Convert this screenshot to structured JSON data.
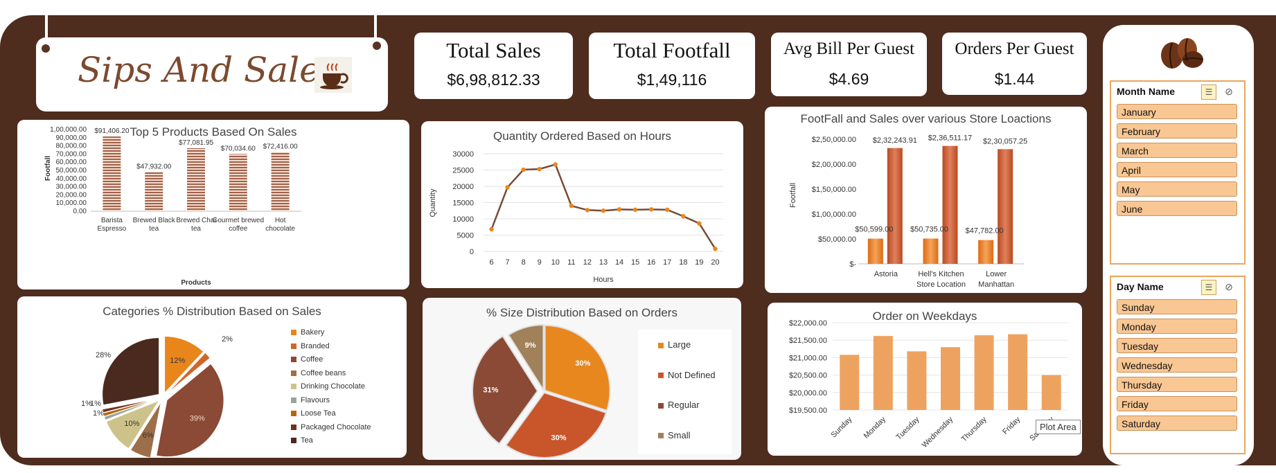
{
  "title": "Sips And Sales",
  "kpis": {
    "total_sales": {
      "label": "Total Sales",
      "value": "$6,98,812.33"
    },
    "total_footfall": {
      "label": "Total Footfall",
      "value": "$1,49,116"
    },
    "avg_bill": {
      "label": "Avg Bill Per Guest",
      "value": "$4.69"
    },
    "orders_per_guest": {
      "label": "Orders Per Guest",
      "value": "$1.44"
    }
  },
  "colors": {
    "background": "#4e2c1e",
    "orange": "#e8871e",
    "rust": "#c8562a",
    "brown": "#8a4a36",
    "tan": "#a0815a",
    "weekday_bar": "#eda35f"
  },
  "chart_data": [
    {
      "id": "top5",
      "type": "bar",
      "title": "Top 5 Products Based On Sales",
      "xlabel": "Products",
      "ylabel": "Footfall",
      "categories": [
        "Barista Espresso",
        "Brewed Black tea",
        "Brewed Chai tea",
        "Gourmet brewed coffee",
        "Hot chocolate"
      ],
      "values": [
        91406.2,
        47932.0,
        77081.95,
        70034.6,
        72416.0
      ],
      "data_labels": [
        "$91,406.20",
        "$47,932.00",
        "$77,081.95",
        "$70,034.60",
        "$72,416.00"
      ],
      "yticks": [
        "0.00",
        "10,000.00",
        "20,000.00",
        "30,000.00",
        "40,000.00",
        "50,000.00",
        "60,000.00",
        "70,000.00",
        "80,000.00",
        "90,000.00",
        "1,00,000.00"
      ],
      "ylim": [
        0,
        100000
      ]
    },
    {
      "id": "hours",
      "type": "line",
      "title": "Quantity Ordered Based on Hours",
      "xlabel": "Hours",
      "ylabel": "Quantity",
      "x": [
        6,
        7,
        8,
        9,
        10,
        11,
        12,
        13,
        14,
        15,
        16,
        17,
        18,
        19,
        20
      ],
      "values": [
        6800,
        19700,
        25100,
        25300,
        26700,
        14000,
        12700,
        12500,
        12900,
        12800,
        12900,
        12800,
        10800,
        8600,
        800
      ],
      "yticks": [
        "0",
        "5000",
        "10000",
        "15000",
        "20000",
        "25000",
        "30000"
      ],
      "ylim": [
        0,
        30000
      ]
    },
    {
      "id": "stores",
      "type": "bar",
      "title": "FootFall and Sales over various Store Loactions",
      "ylabel": "Footfall",
      "categories": [
        "Astoria",
        "Hell's Kitchen Store Location",
        "Lower Manhattan"
      ],
      "series": [
        {
          "values": [
            50599.0,
            50735.0,
            47782.0
          ],
          "labels": [
            "$50,599.00",
            "$50,735.00",
            "$47,782.00"
          ]
        },
        {
          "values": [
            232243.91,
            236511.17,
            230057.25
          ],
          "labels": [
            "$2,32,243.91",
            "$2,36,511.17",
            "$2,30,057.25"
          ]
        }
      ],
      "yticks": [
        "$-",
        "$50,000.00",
        "$1,00,000.00",
        "$1,50,000.00",
        "$2,00,000.00",
        "$2,50,000.00"
      ],
      "ylim": [
        0,
        250000
      ]
    },
    {
      "id": "categories",
      "type": "pie",
      "title": "Categories % Distribution Based on Sales",
      "categories": [
        "Bakery",
        "Branded",
        "Coffee",
        "Coffee beans",
        "Drinking Chocolate",
        "Flavours",
        "Loose Tea",
        "Packaged Chocolate",
        "Tea"
      ],
      "values": [
        12,
        2,
        39,
        6,
        10,
        1,
        1,
        1,
        28
      ],
      "data_labels": [
        "12%",
        "2%",
        "39%",
        "6%",
        "10%",
        "1%",
        "1%",
        "1%",
        "28%"
      ]
    },
    {
      "id": "sizes",
      "type": "pie",
      "title": "% Size Distribution Based on Orders",
      "categories": [
        "Large",
        "Not Defined",
        "Regular",
        "Small"
      ],
      "values": [
        30,
        30,
        31,
        9
      ],
      "data_labels": [
        "30%",
        "30%",
        "31%",
        "9%"
      ]
    },
    {
      "id": "weekdays",
      "type": "bar",
      "title": "Order on Weekdays",
      "categories": [
        "Sunday",
        "Monday",
        "Tuesday",
        "Wednesday",
        "Thursday",
        "Friday",
        "Saturday"
      ],
      "values": [
        21080,
        21620,
        21180,
        21300,
        21640,
        21670,
        20500
      ],
      "yticks": [
        "$19,500.00",
        "$20,000.00",
        "$20,500.00",
        "$21,000.00",
        "$21,500.00",
        "$22,000.00"
      ],
      "ylim": [
        19500,
        22000
      ]
    }
  ],
  "tooltip": "Plot Area",
  "slicers": {
    "month": {
      "title": "Month Name",
      "items": [
        "January",
        "February",
        "March",
        "April",
        "May",
        "June"
      ]
    },
    "day": {
      "title": "Day Name",
      "items": [
        "Sunday",
        "Monday",
        "Tuesday",
        "Wednesday",
        "Thursday",
        "Friday",
        "Saturday"
      ]
    }
  }
}
